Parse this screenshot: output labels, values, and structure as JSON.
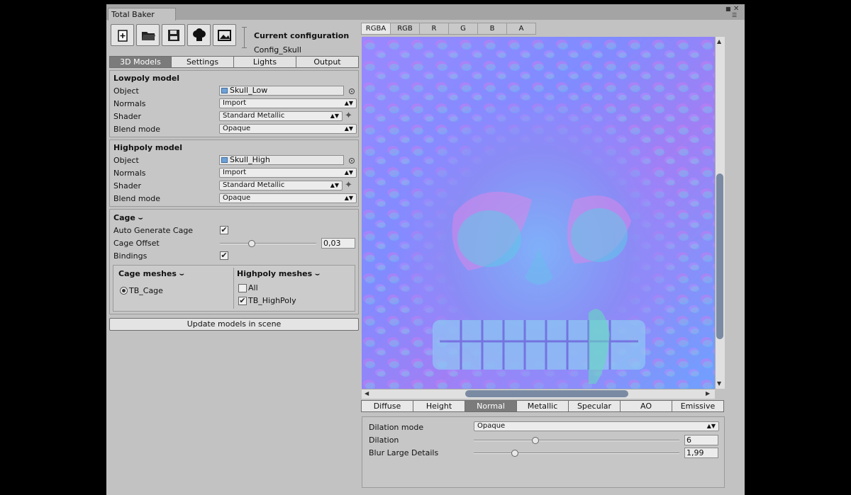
{
  "window": {
    "title": "Total Baker"
  },
  "toolbar": {
    "buttons": [
      {
        "name": "new-config-button",
        "icon": "new-file-icon"
      },
      {
        "name": "open-config-button",
        "icon": "folder-icon"
      },
      {
        "name": "save-config-button",
        "icon": "floppy-disk-icon"
      },
      {
        "name": "bake-button",
        "icon": "chef-hat-icon"
      },
      {
        "name": "export-button",
        "icon": "image-export-icon"
      }
    ],
    "current_config_label": "Current configuration",
    "current_config_value": "Config_Skull"
  },
  "main_tabs": [
    "3D Models",
    "Settings",
    "Lights",
    "Output"
  ],
  "main_tab_active": "3D Models",
  "lowpoly": {
    "title": "Lowpoly model",
    "object_label": "Object",
    "object_value": "Skull_Low",
    "normals_label": "Normals",
    "normals_value": "Import",
    "shader_label": "Shader",
    "shader_value": "Standard Metallic",
    "blend_label": "Blend mode",
    "blend_value": "Opaque"
  },
  "highpoly": {
    "title": "Highpoly model",
    "object_label": "Object",
    "object_value": "Skull_High",
    "normals_label": "Normals",
    "normals_value": "Import",
    "shader_label": "Shader",
    "shader_value": "Standard Metallic",
    "blend_label": "Blend mode",
    "blend_value": "Opaque"
  },
  "cage": {
    "title": "Cage",
    "auto_generate_label": "Auto Generate Cage",
    "auto_generate": true,
    "offset_label": "Cage Offset",
    "offset_value": "0,03",
    "offset_fraction": 0.33,
    "bindings_label": "Bindings",
    "bindings": true,
    "cage_meshes_title": "Cage meshes",
    "cage_meshes": [
      "TB_Cage"
    ],
    "highpoly_meshes_title": "Highpoly meshes",
    "highpoly_all_label": "All",
    "highpoly_all": false,
    "highpoly_meshes": [
      {
        "label": "TB_HighPoly",
        "checked": true
      }
    ]
  },
  "update_button": "Update models in scene",
  "channels": [
    "RGBA",
    "RGB",
    "R",
    "G",
    "B",
    "A"
  ],
  "channel_active": "RGBA",
  "map_tabs": [
    "Diffuse",
    "Height",
    "Normal",
    "Metallic",
    "Specular",
    "AO",
    "Emissive"
  ],
  "map_active": "Normal",
  "map_settings": {
    "dilation_mode_label": "Dilation mode",
    "dilation_mode_value": "Opaque",
    "dilation_label": "Dilation",
    "dilation_value": "6",
    "dilation_fraction": 0.3,
    "blur_label": "Blur Large Details",
    "blur_value": "1,99",
    "blur_fraction": 0.2
  },
  "colors": {
    "active_tab": "#7b7b7b",
    "scroll_thumb": "#7b8aa3",
    "normal_map_base": "#8a80ff"
  }
}
